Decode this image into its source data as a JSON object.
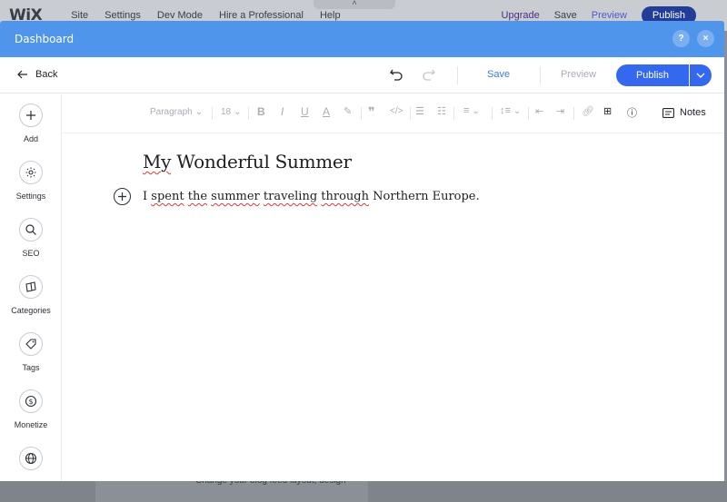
{
  "background": {
    "logo": "WiX",
    "menu": [
      "Site",
      "Settings",
      "Dev Mode",
      "Hire a Professional",
      "Help"
    ],
    "upgrade": "Upgrade",
    "save": "Save",
    "preview": "Preview",
    "publish": "Publish",
    "footer_text": "Change your blog feed layout, design"
  },
  "modal": {
    "title": "Dashboard",
    "help_label": "?",
    "close_label": "×"
  },
  "actionbar": {
    "back_label": "Back",
    "save_label": "Save",
    "preview_label": "Preview",
    "publish_label": "Publish"
  },
  "sidebar": {
    "items": [
      {
        "label": "Add",
        "icon": "plus-icon"
      },
      {
        "label": "Settings",
        "icon": "gear-icon"
      },
      {
        "label": "SEO",
        "icon": "search-icon"
      },
      {
        "label": "Categories",
        "icon": "categories-icon"
      },
      {
        "label": "Tags",
        "icon": "tag-icon"
      },
      {
        "label": "Monetize",
        "icon": "dollar-icon"
      },
      {
        "label": "",
        "icon": "globe-icon"
      }
    ]
  },
  "toolbar": {
    "paragraph": "Paragraph",
    "font_size": "18",
    "notes_label": "Notes"
  },
  "post": {
    "title_words": [
      "My",
      "Wonderful Summer"
    ],
    "body": {
      "w1": "I",
      "w2": "spent",
      "w3": "the",
      "w4": "summer",
      "w5": "traveling",
      "w6": "through",
      "w7": "Northern Europe."
    }
  },
  "colors": {
    "header_blue": "#4f95eb",
    "publish_blue": "#3468ee",
    "save_blue": "#3b7ae6"
  }
}
